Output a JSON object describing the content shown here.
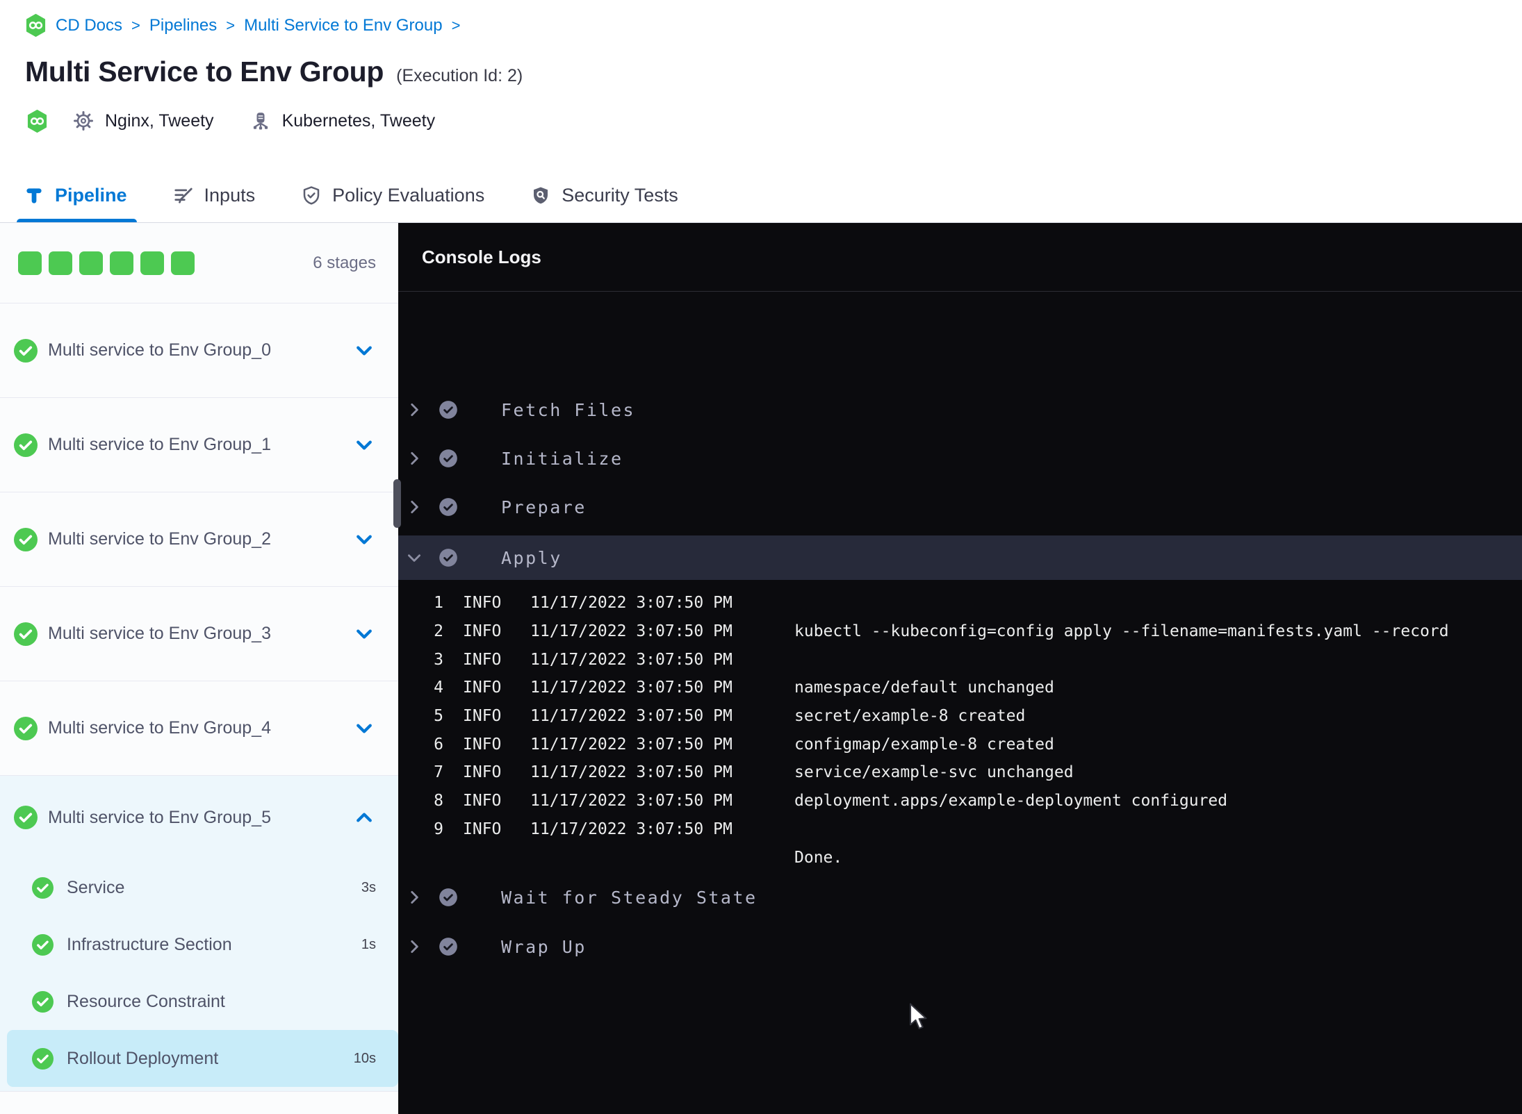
{
  "colors": {
    "accent_blue": "#0278d5",
    "success_green": "#4dc952",
    "console_bg": "#0b0b0e",
    "console_step_highlight": "#272a3a",
    "selected_substep_bg": "#c8ecf9",
    "expanded_stage_bg": "#edf7fc"
  },
  "breadcrumb": {
    "separator": ">",
    "items": [
      "CD Docs",
      "Pipelines",
      "Multi Service to Env Group"
    ]
  },
  "header": {
    "title": "Multi Service to Env Group",
    "execution_id": "(Execution Id: 2)",
    "services": "Nginx, Tweety",
    "environments": "Kubernetes, Tweety"
  },
  "tabs": [
    {
      "label": "Pipeline",
      "icon": "pipeline-icon",
      "active": true
    },
    {
      "label": "Inputs",
      "icon": "inputs-icon",
      "active": false
    },
    {
      "label": "Policy Evaluations",
      "icon": "policy-shield-check-icon",
      "active": false
    },
    {
      "label": "Security Tests",
      "icon": "security-shield-search-icon",
      "active": false
    }
  ],
  "stage_panel": {
    "stage_count": "6 stages",
    "progress_square_count": 6,
    "stages": [
      {
        "name": "Multi service to Env Group_0",
        "status": "success",
        "expanded": false
      },
      {
        "name": "Multi service to Env Group_1",
        "status": "success",
        "expanded": false
      },
      {
        "name": "Multi service to Env Group_2",
        "status": "success",
        "expanded": false
      },
      {
        "name": "Multi service to Env Group_3",
        "status": "success",
        "expanded": false
      },
      {
        "name": "Multi service to Env Group_4",
        "status": "success",
        "expanded": false
      },
      {
        "name": "Multi service to Env Group_5",
        "status": "success",
        "expanded": true,
        "steps": [
          {
            "name": "Service",
            "duration": "3s",
            "status": "success",
            "selected": false
          },
          {
            "name": "Infrastructure Section",
            "duration": "1s",
            "status": "success",
            "selected": false
          },
          {
            "name": "Resource Constraint",
            "duration": "",
            "status": "success",
            "selected": false
          },
          {
            "name": "Rollout Deployment",
            "duration": "10s",
            "status": "success",
            "selected": true
          }
        ]
      }
    ]
  },
  "console": {
    "title": "Console Logs",
    "steps": [
      {
        "name": "Fetch Files",
        "status": "success",
        "expanded": false
      },
      {
        "name": "Initialize",
        "status": "success",
        "expanded": false
      },
      {
        "name": "Prepare",
        "status": "success",
        "expanded": false
      },
      {
        "name": "Apply",
        "status": "success",
        "expanded": true
      },
      {
        "name": "Wait for Steady State",
        "status": "success",
        "expanded": false
      },
      {
        "name": "Wrap Up",
        "status": "success",
        "expanded": false
      }
    ],
    "logs": [
      {
        "line": "1",
        "level": "INFO",
        "timestamp": "11/17/2022 3:07:50 PM",
        "message": ""
      },
      {
        "line": "2",
        "level": "INFO",
        "timestamp": "11/17/2022 3:07:50 PM",
        "message": "kubectl --kubeconfig=config apply --filename=manifests.yaml --record"
      },
      {
        "line": "3",
        "level": "INFO",
        "timestamp": "11/17/2022 3:07:50 PM",
        "message": ""
      },
      {
        "line": "4",
        "level": "INFO",
        "timestamp": "11/17/2022 3:07:50 PM",
        "message": "namespace/default unchanged"
      },
      {
        "line": "5",
        "level": "INFO",
        "timestamp": "11/17/2022 3:07:50 PM",
        "message": "secret/example-8 created"
      },
      {
        "line": "6",
        "level": "INFO",
        "timestamp": "11/17/2022 3:07:50 PM",
        "message": "configmap/example-8 created"
      },
      {
        "line": "7",
        "level": "INFO",
        "timestamp": "11/17/2022 3:07:50 PM",
        "message": "service/example-svc unchanged"
      },
      {
        "line": "8",
        "level": "INFO",
        "timestamp": "11/17/2022 3:07:50 PM",
        "message": "deployment.apps/example-deployment configured"
      },
      {
        "line": "9",
        "level": "INFO",
        "timestamp": "11/17/2022 3:07:50 PM",
        "message": ""
      },
      {
        "line": "",
        "level": "",
        "timestamp": "",
        "message": "Done."
      }
    ]
  }
}
